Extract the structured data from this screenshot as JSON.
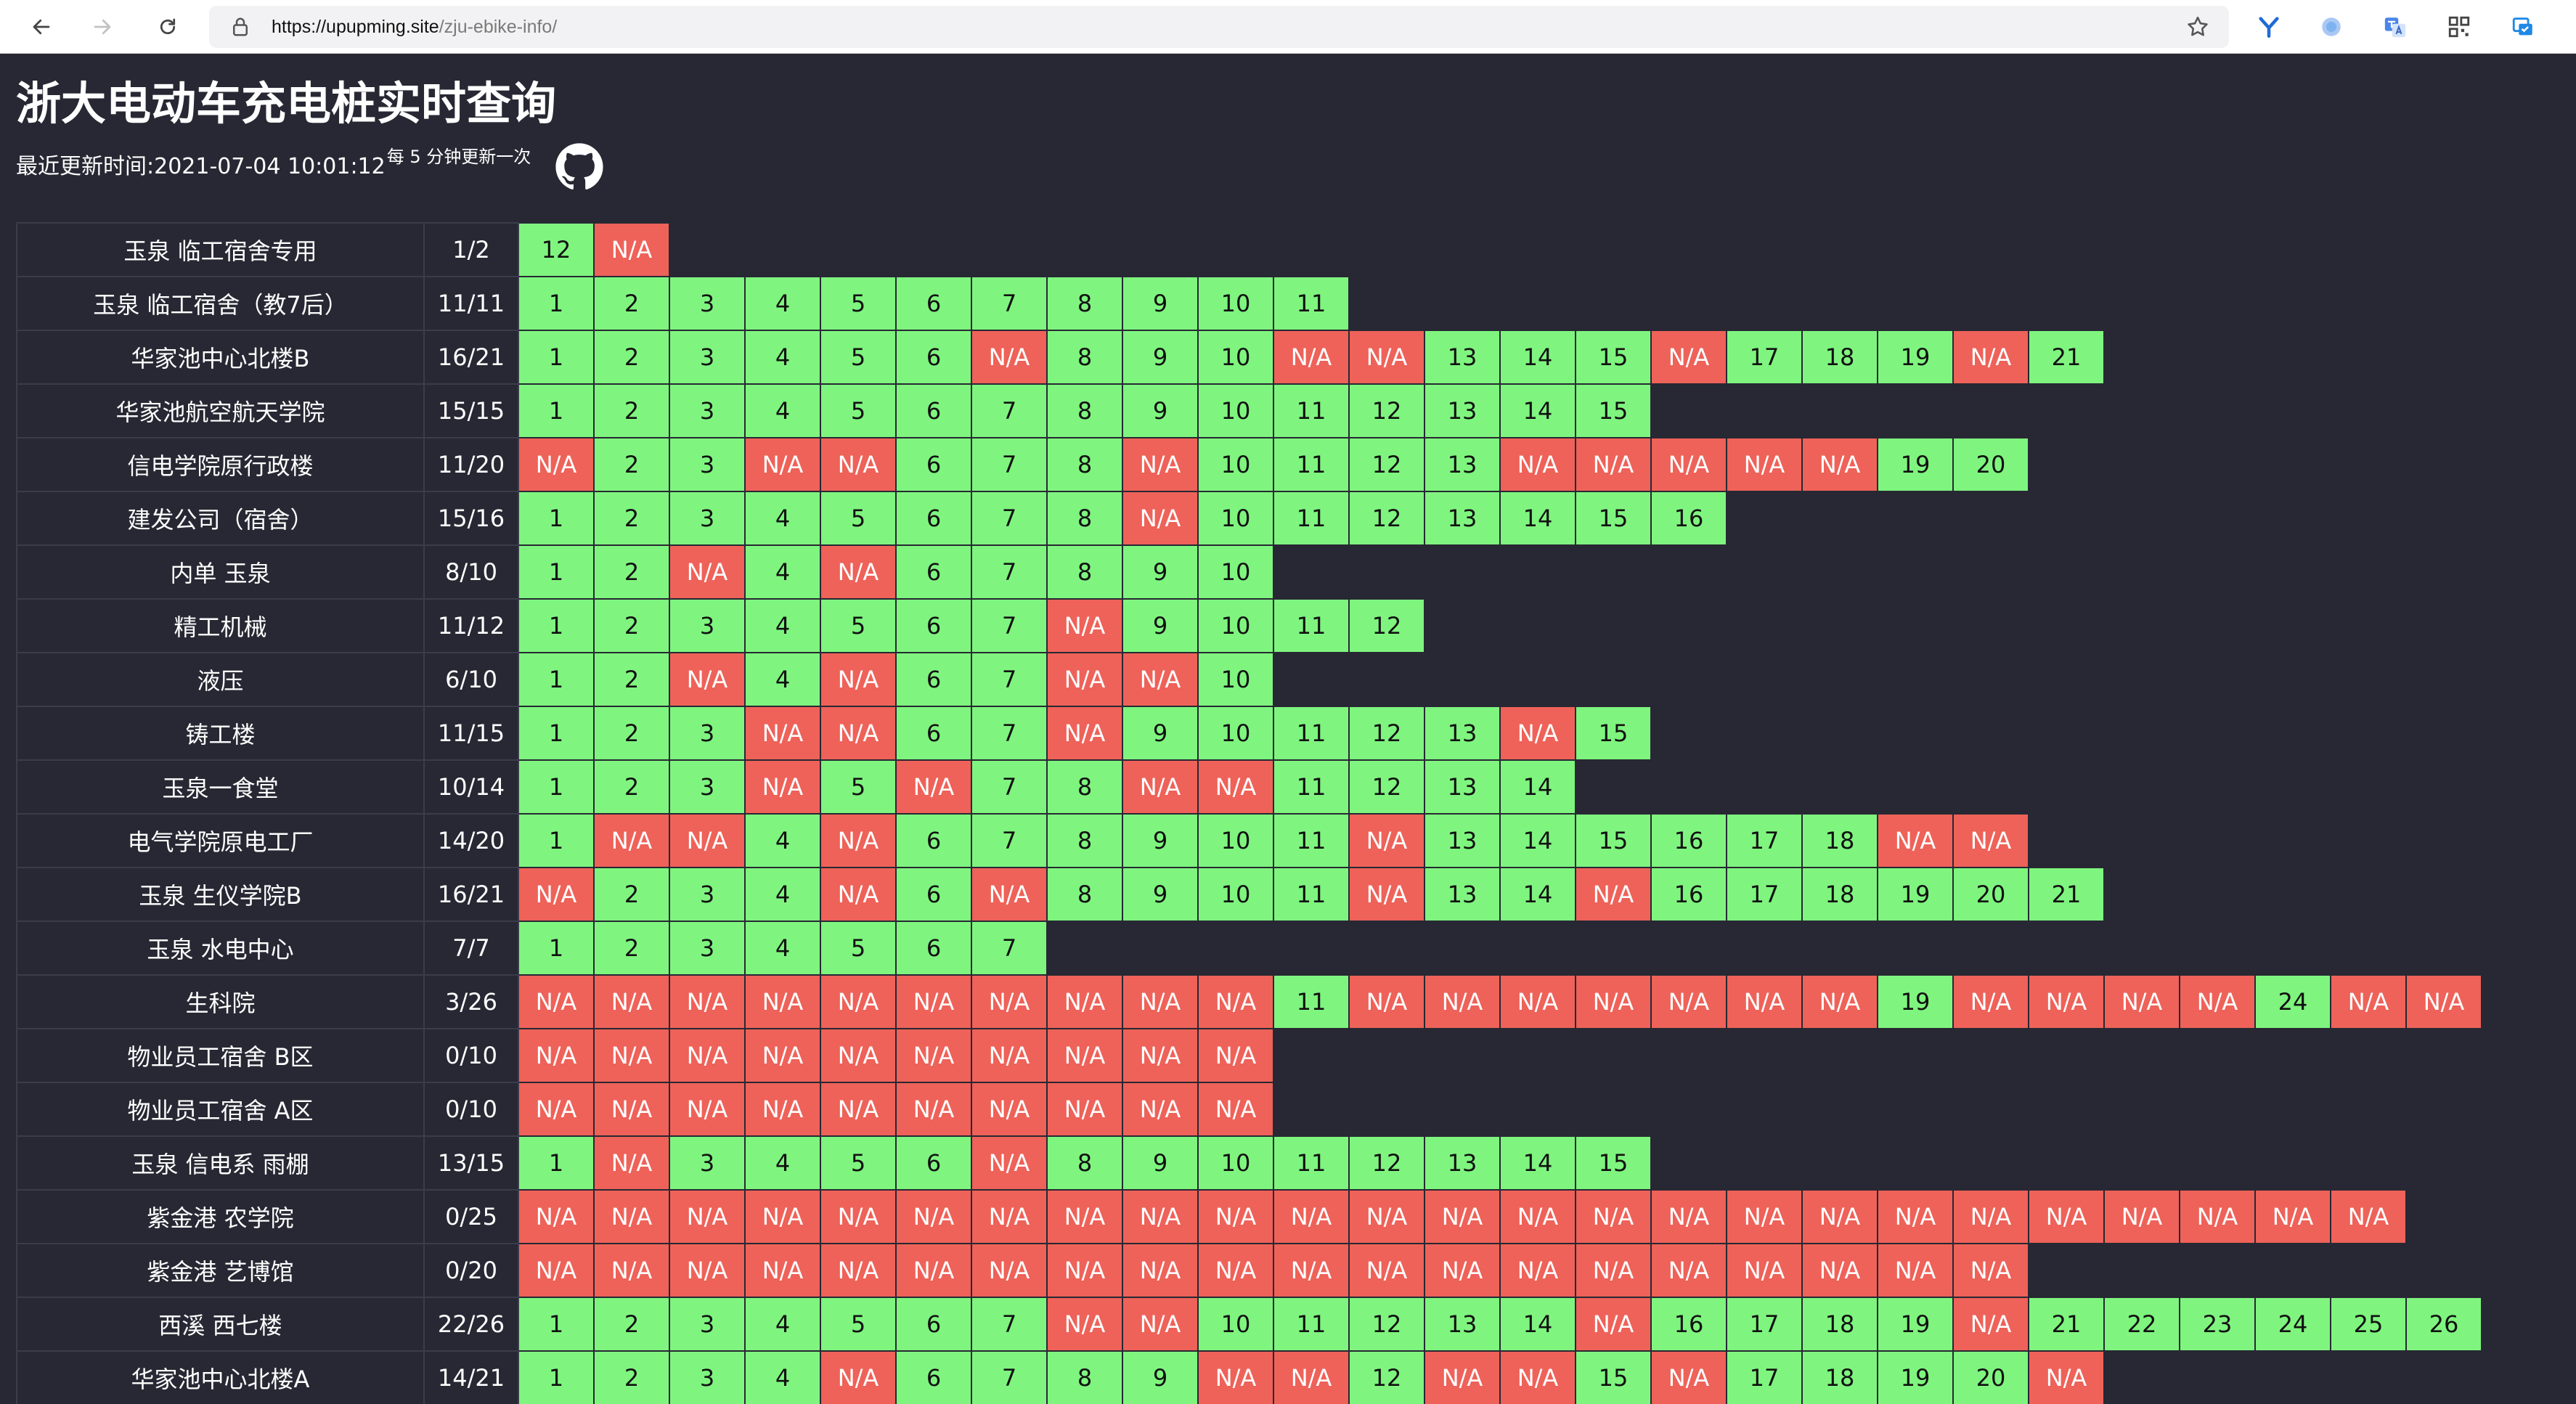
{
  "browser": {
    "url_host": "https://upupming.site",
    "url_path": "/zju-ebike-info/"
  },
  "page": {
    "title": "浙大电动车充电桩实时查询",
    "update_label": "最近更新时间: ",
    "update_time": "2021-07-04 10:01:12",
    "update_note": "每 5 分钟更新一次"
  },
  "colors": {
    "available": "#7ff57f",
    "unavailable": "#ee6259",
    "background": "#272833"
  },
  "stations": [
    {
      "name": "玉泉 临工宿舍专用",
      "count": "1/2",
      "slots": [
        "12",
        "N/A"
      ]
    },
    {
      "name": "玉泉 临工宿舍（教7后）",
      "count": "11/11",
      "slots": [
        "1",
        "2",
        "3",
        "4",
        "5",
        "6",
        "7",
        "8",
        "9",
        "10",
        "11"
      ]
    },
    {
      "name": "华家池中心北楼B",
      "count": "16/21",
      "slots": [
        "1",
        "2",
        "3",
        "4",
        "5",
        "6",
        "N/A",
        "8",
        "9",
        "10",
        "N/A",
        "N/A",
        "13",
        "14",
        "15",
        "N/A",
        "17",
        "18",
        "19",
        "N/A",
        "21"
      ]
    },
    {
      "name": "华家池航空航天学院",
      "count": "15/15",
      "slots": [
        "1",
        "2",
        "3",
        "4",
        "5",
        "6",
        "7",
        "8",
        "9",
        "10",
        "11",
        "12",
        "13",
        "14",
        "15"
      ]
    },
    {
      "name": "信电学院原行政楼",
      "count": "11/20",
      "slots": [
        "N/A",
        "2",
        "3",
        "N/A",
        "N/A",
        "6",
        "7",
        "8",
        "N/A",
        "10",
        "11",
        "12",
        "13",
        "N/A",
        "N/A",
        "N/A",
        "N/A",
        "N/A",
        "19",
        "20"
      ]
    },
    {
      "name": "建发公司（宿舍）",
      "count": "15/16",
      "slots": [
        "1",
        "2",
        "3",
        "4",
        "5",
        "6",
        "7",
        "8",
        "N/A",
        "10",
        "11",
        "12",
        "13",
        "14",
        "15",
        "16"
      ]
    },
    {
      "name": "内单 玉泉",
      "count": "8/10",
      "slots": [
        "1",
        "2",
        "N/A",
        "4",
        "N/A",
        "6",
        "7",
        "8",
        "9",
        "10"
      ]
    },
    {
      "name": "精工机械",
      "count": "11/12",
      "slots": [
        "1",
        "2",
        "3",
        "4",
        "5",
        "6",
        "7",
        "N/A",
        "9",
        "10",
        "11",
        "12"
      ]
    },
    {
      "name": "液压",
      "count": "6/10",
      "slots": [
        "1",
        "2",
        "N/A",
        "4",
        "N/A",
        "6",
        "7",
        "N/A",
        "N/A",
        "10"
      ]
    },
    {
      "name": "铸工楼",
      "count": "11/15",
      "slots": [
        "1",
        "2",
        "3",
        "N/A",
        "N/A",
        "6",
        "7",
        "N/A",
        "9",
        "10",
        "11",
        "12",
        "13",
        "N/A",
        "15"
      ]
    },
    {
      "name": "玉泉一食堂",
      "count": "10/14",
      "slots": [
        "1",
        "2",
        "3",
        "N/A",
        "5",
        "N/A",
        "7",
        "8",
        "N/A",
        "N/A",
        "11",
        "12",
        "13",
        "14"
      ]
    },
    {
      "name": "电气学院原电工厂",
      "count": "14/20",
      "slots": [
        "1",
        "N/A",
        "N/A",
        "4",
        "N/A",
        "6",
        "7",
        "8",
        "9",
        "10",
        "11",
        "N/A",
        "13",
        "14",
        "15",
        "16",
        "17",
        "18",
        "N/A",
        "N/A"
      ]
    },
    {
      "name": "玉泉 生仪学院B",
      "count": "16/21",
      "slots": [
        "N/A",
        "2",
        "3",
        "4",
        "N/A",
        "6",
        "N/A",
        "8",
        "9",
        "10",
        "11",
        "N/A",
        "13",
        "14",
        "N/A",
        "16",
        "17",
        "18",
        "19",
        "20",
        "21"
      ]
    },
    {
      "name": "玉泉 水电中心",
      "count": "7/7",
      "slots": [
        "1",
        "2",
        "3",
        "4",
        "5",
        "6",
        "7"
      ]
    },
    {
      "name": "生科院",
      "count": "3/26",
      "slots": [
        "N/A",
        "N/A",
        "N/A",
        "N/A",
        "N/A",
        "N/A",
        "N/A",
        "N/A",
        "N/A",
        "N/A",
        "11",
        "N/A",
        "N/A",
        "N/A",
        "N/A",
        "N/A",
        "N/A",
        "N/A",
        "19",
        "N/A",
        "N/A",
        "N/A",
        "N/A",
        "24",
        "N/A",
        "N/A"
      ]
    },
    {
      "name": "物业员工宿舍 B区",
      "count": "0/10",
      "slots": [
        "N/A",
        "N/A",
        "N/A",
        "N/A",
        "N/A",
        "N/A",
        "N/A",
        "N/A",
        "N/A",
        "N/A"
      ]
    },
    {
      "name": "物业员工宿舍 A区",
      "count": "0/10",
      "slots": [
        "N/A",
        "N/A",
        "N/A",
        "N/A",
        "N/A",
        "N/A",
        "N/A",
        "N/A",
        "N/A",
        "N/A"
      ]
    },
    {
      "name": "玉泉 信电系 雨棚",
      "count": "13/15",
      "slots": [
        "1",
        "N/A",
        "3",
        "4",
        "5",
        "6",
        "N/A",
        "8",
        "9",
        "10",
        "11",
        "12",
        "13",
        "14",
        "15"
      ]
    },
    {
      "name": "紫金港 农学院",
      "count": "0/25",
      "slots": [
        "N/A",
        "N/A",
        "N/A",
        "N/A",
        "N/A",
        "N/A",
        "N/A",
        "N/A",
        "N/A",
        "N/A",
        "N/A",
        "N/A",
        "N/A",
        "N/A",
        "N/A",
        "N/A",
        "N/A",
        "N/A",
        "N/A",
        "N/A",
        "N/A",
        "N/A",
        "N/A",
        "N/A",
        "N/A"
      ]
    },
    {
      "name": "紫金港 艺博馆",
      "count": "0/20",
      "slots": [
        "N/A",
        "N/A",
        "N/A",
        "N/A",
        "N/A",
        "N/A",
        "N/A",
        "N/A",
        "N/A",
        "N/A",
        "N/A",
        "N/A",
        "N/A",
        "N/A",
        "N/A",
        "N/A",
        "N/A",
        "N/A",
        "N/A",
        "N/A"
      ]
    },
    {
      "name": "西溪 西七楼",
      "count": "22/26",
      "slots": [
        "1",
        "2",
        "3",
        "4",
        "5",
        "6",
        "7",
        "N/A",
        "N/A",
        "10",
        "11",
        "12",
        "13",
        "14",
        "N/A",
        "16",
        "17",
        "18",
        "19",
        "N/A",
        "21",
        "22",
        "23",
        "24",
        "25",
        "26"
      ]
    },
    {
      "name": "华家池中心北楼A",
      "count": "14/21",
      "slots": [
        "1",
        "2",
        "3",
        "4",
        "N/A",
        "6",
        "7",
        "8",
        "9",
        "N/A",
        "N/A",
        "12",
        "N/A",
        "N/A",
        "15",
        "N/A",
        "17",
        "18",
        "19",
        "20",
        "N/A"
      ]
    }
  ]
}
